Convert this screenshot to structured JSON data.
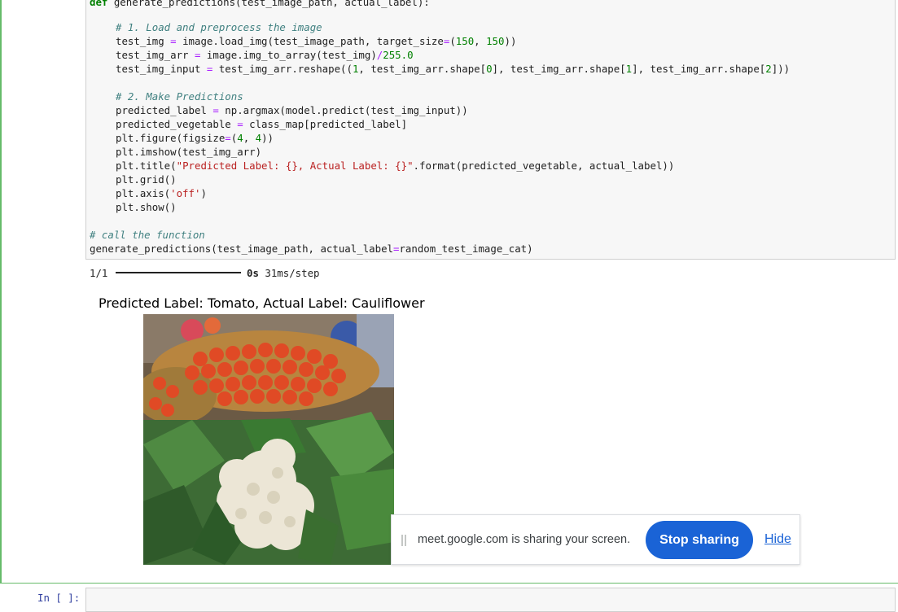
{
  "code": {
    "lines": [
      {
        "indent": 0,
        "parts": [
          {
            "t": "def",
            "c": "kw"
          },
          {
            "t": " generate_predictions(test_image_path, actual_label):"
          }
        ]
      },
      {
        "indent": 1,
        "parts": [
          {
            "t": "# 1. Load and preprocess the image",
            "c": "cm"
          }
        ]
      },
      {
        "indent": 1,
        "parts": [
          {
            "t": "test_img "
          },
          {
            "t": "=",
            "c": "op"
          },
          {
            "t": " image.load_img(test_image_path, target_size"
          },
          {
            "t": "=",
            "c": "op"
          },
          {
            "t": "("
          },
          {
            "t": "150",
            "c": "num"
          },
          {
            "t": ", "
          },
          {
            "t": "150",
            "c": "num"
          },
          {
            "t": "))"
          }
        ]
      },
      {
        "indent": 1,
        "parts": [
          {
            "t": "test_img_arr "
          },
          {
            "t": "=",
            "c": "op"
          },
          {
            "t": " image.img_to_array(test_img)"
          },
          {
            "t": "/",
            "c": "op"
          },
          {
            "t": "255.0",
            "c": "num"
          }
        ]
      },
      {
        "indent": 1,
        "parts": [
          {
            "t": "test_img_input "
          },
          {
            "t": "=",
            "c": "op"
          },
          {
            "t": " test_img_arr.reshape(("
          },
          {
            "t": "1",
            "c": "num"
          },
          {
            "t": ", test_img_arr.shape["
          },
          {
            "t": "0",
            "c": "num"
          },
          {
            "t": "], test_img_arr.shape["
          },
          {
            "t": "1",
            "c": "num"
          },
          {
            "t": "], test_img_arr.shape["
          },
          {
            "t": "2",
            "c": "num"
          },
          {
            "t": "]))"
          }
        ]
      },
      {
        "indent": 1,
        "parts": [
          {
            "t": "# 2. Make Predictions",
            "c": "cm"
          }
        ]
      },
      {
        "indent": 1,
        "parts": [
          {
            "t": "predicted_label "
          },
          {
            "t": "=",
            "c": "op"
          },
          {
            "t": " np.argmax(model.predict(test_img_input))"
          }
        ]
      },
      {
        "indent": 1,
        "parts": [
          {
            "t": "predicted_vegetable "
          },
          {
            "t": "=",
            "c": "op"
          },
          {
            "t": " class_map[predicted_label]"
          }
        ]
      },
      {
        "indent": 1,
        "parts": [
          {
            "t": "plt.figure(figsize"
          },
          {
            "t": "=",
            "c": "op"
          },
          {
            "t": "("
          },
          {
            "t": "4",
            "c": "num"
          },
          {
            "t": ", "
          },
          {
            "t": "4",
            "c": "num"
          },
          {
            "t": "))"
          }
        ]
      },
      {
        "indent": 1,
        "parts": [
          {
            "t": "plt.imshow(test_img_arr)"
          }
        ]
      },
      {
        "indent": 1,
        "parts": [
          {
            "t": "plt.title("
          },
          {
            "t": "\"Predicted Label: {}, Actual Label: {}\"",
            "c": "str"
          },
          {
            "t": ".format(predicted_vegetable, actual_label))"
          }
        ]
      },
      {
        "indent": 1,
        "parts": [
          {
            "t": "plt.grid()"
          }
        ]
      },
      {
        "indent": 1,
        "parts": [
          {
            "t": "plt.axis("
          },
          {
            "t": "'off'",
            "c": "str"
          },
          {
            "t": ")"
          }
        ]
      },
      {
        "indent": 1,
        "parts": [
          {
            "t": "plt.show()"
          }
        ]
      },
      {
        "indent": 0,
        "parts": [
          {
            "t": "# call the function",
            "c": "cm"
          }
        ]
      },
      {
        "indent": 0,
        "parts": [
          {
            "t": "generate_predictions(test_image_path, actual_label"
          },
          {
            "t": "=",
            "c": "op"
          },
          {
            "t": "random_test_image_cat)"
          }
        ]
      }
    ]
  },
  "output": {
    "progress_count": "1/1",
    "progress_fraction": 1.0,
    "progress_time": "0s",
    "progress_step": " 31ms/step",
    "plot_title": "Predicted Label: Tomato, Actual Label: Cauliflower"
  },
  "share_banner": {
    "message": "meet.google.com is sharing your screen.",
    "stop_label": "Stop sharing",
    "hide_label": "Hide"
  },
  "next_cell": {
    "prompt": "In [ ]:"
  },
  "colors": {
    "cell_border": "#66bb6a",
    "button_blue": "#1a63d6"
  }
}
